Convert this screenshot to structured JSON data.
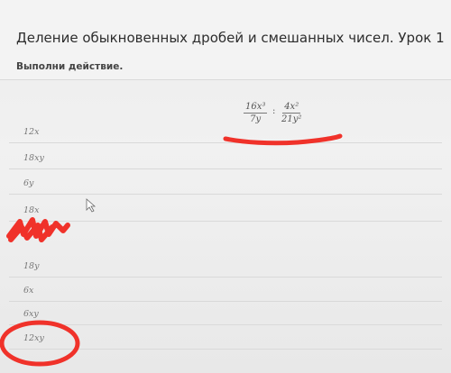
{
  "header": {
    "title": "Деление обыкновенных дробей и смешанных чисел. Урок 1",
    "instruction": "Выполни действие."
  },
  "expression": {
    "frac1_num": "16x³",
    "frac1_den": "7y",
    "operator": ":",
    "frac2_num": "4x²",
    "frac2_den": "21y²"
  },
  "options": [
    "12x",
    "18xy",
    "6y",
    "18x",
    "18y",
    "6x",
    "6xy",
    "12xy"
  ],
  "annotations": {
    "pen_color": "#f0322a",
    "underline_target": "expression",
    "scribble_over": "option-4",
    "circled_answer": "12xy"
  }
}
